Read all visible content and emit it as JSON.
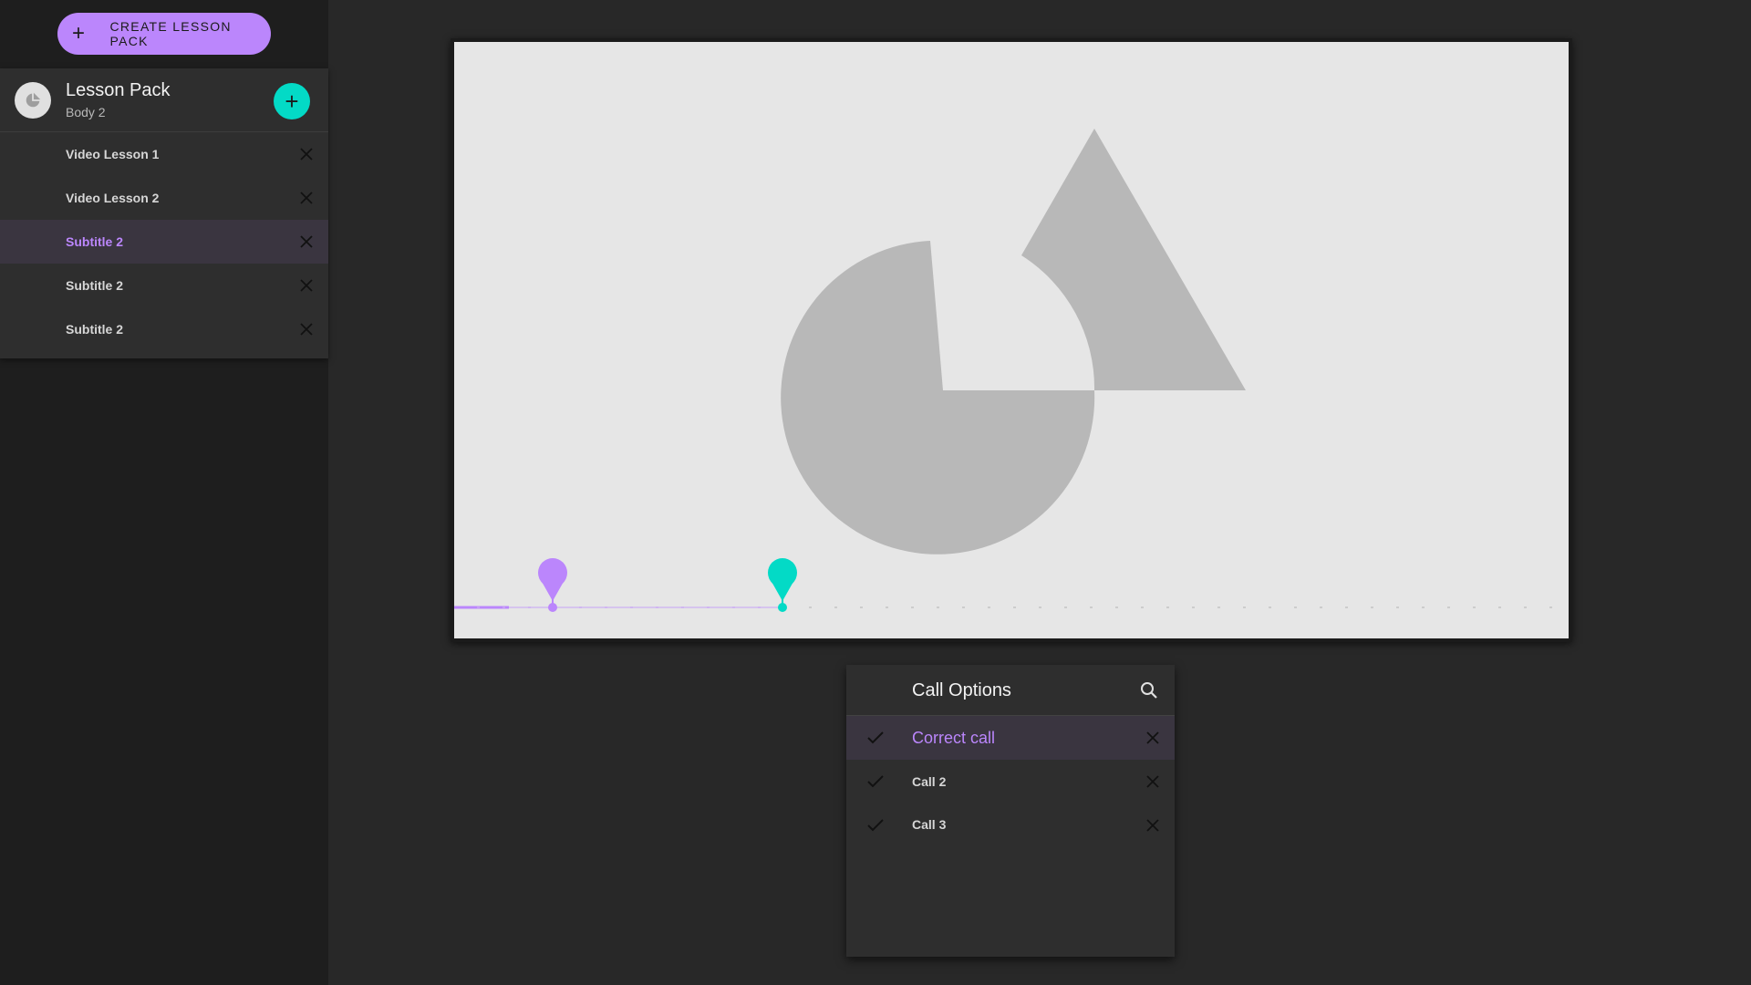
{
  "sidebar": {
    "create_button_label": "CREATE LESSON PACK",
    "pack": {
      "title": "Lesson Pack",
      "subtitle": "Body 2",
      "items": [
        {
          "label": "Video Lesson 1"
        },
        {
          "label": "Video Lesson 2"
        },
        {
          "label": "Subtitle 2",
          "selected": true
        },
        {
          "label": "Subtitle 2"
        },
        {
          "label": "Subtitle 2"
        }
      ]
    }
  },
  "video": {
    "timeline_markers": [
      {
        "name": "marker-purple",
        "color": "#bb86fc"
      },
      {
        "name": "marker-teal",
        "color": "#03dac6"
      }
    ]
  },
  "call_options": {
    "title": "Call Options",
    "items": [
      {
        "label": "Correct call",
        "selected": true
      },
      {
        "label": "Call 2"
      },
      {
        "label": "Call 3"
      }
    ]
  },
  "colors": {
    "accent_purple": "#bb86fc",
    "accent_teal": "#03dac6",
    "background": "#282828",
    "panel": "#2e2e2e"
  },
  "icons": {
    "create": "plus-icon",
    "add": "plus-icon",
    "remove": "close-icon",
    "search": "search-icon",
    "check": "check-icon"
  }
}
